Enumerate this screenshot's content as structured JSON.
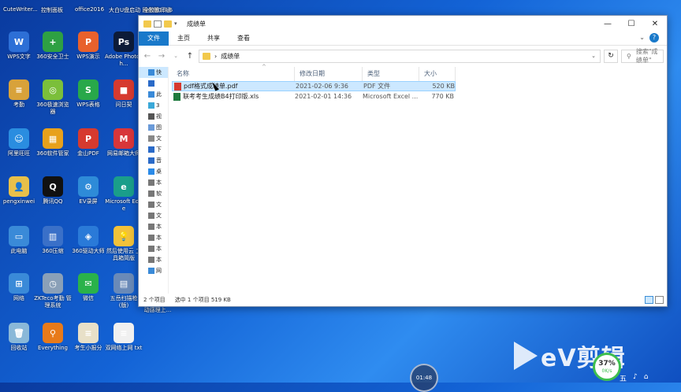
{
  "desktop": {
    "top_labels": [
      "CuteWriter...",
      "控制面板",
      "office2016",
      "大白U盘启动 网盘版1.7.5",
      "全校教师通"
    ],
    "icons": [
      {
        "label": "WPS文字",
        "icon": "wps-writer-icon",
        "color": "#2d6fd6",
        "glyph": "W"
      },
      {
        "label": "360安全卫士",
        "icon": "shield-icon",
        "color": "#2ea043",
        "glyph": "+"
      },
      {
        "label": "WPS演示",
        "icon": "wps-presentation-icon",
        "color": "#e8612c",
        "glyph": "P"
      },
      {
        "label": "Adobe Photosh...",
        "icon": "photoshop-icon",
        "color": "#0d1b38",
        "glyph": "Ps"
      },
      {
        "label": "考勤",
        "icon": "document-icon",
        "color": "#d8a23a",
        "glyph": "≡"
      },
      {
        "label": "360极速浏览器",
        "icon": "browser-icon",
        "color": "#7bbf3a",
        "glyph": "◎"
      },
      {
        "label": "WPS表格",
        "icon": "wps-spreadsheet-icon",
        "color": "#28a84a",
        "glyph": "S"
      },
      {
        "label": "问日契",
        "icon": "app-icon",
        "color": "#d63a2f",
        "glyph": "■"
      },
      {
        "label": "阿里旺旺",
        "icon": "chat-icon",
        "color": "#2a8de0",
        "glyph": "☺"
      },
      {
        "label": "360软件管家",
        "icon": "apps-icon",
        "color": "#e8a11c",
        "glyph": "▦"
      },
      {
        "label": "金山PDF",
        "icon": "pdf-icon",
        "color": "#d63a2f",
        "glyph": "P"
      },
      {
        "label": "网易邮箱大师",
        "icon": "mail-icon",
        "color": "#d8363a",
        "glyph": "M"
      },
      {
        "label": "pengxinwei",
        "icon": "user-folder-icon",
        "color": "#e8c04a",
        "glyph": "👤"
      },
      {
        "label": "腾讯QQ",
        "icon": "qq-penguin-icon",
        "color": "#111111",
        "glyph": "Q"
      },
      {
        "label": "EV录屏",
        "icon": "gear-icon",
        "color": "#2e8bd8",
        "glyph": "⚙"
      },
      {
        "label": "Microsoft Edge",
        "icon": "edge-icon",
        "color": "#1a9e8a",
        "glyph": "e"
      },
      {
        "label": "此电脑",
        "icon": "computer-icon",
        "color": "#3a8ad8",
        "glyph": "▭"
      },
      {
        "label": "360压缩",
        "icon": "archive-icon",
        "color": "#3a70c8",
        "glyph": "▥"
      },
      {
        "label": "360驱动大师",
        "icon": "driver-icon",
        "color": "#2a7ad8",
        "glyph": "◈"
      },
      {
        "label": "然后使用云 工具箱简版",
        "icon": "bulb-icon",
        "color": "#f2c23a",
        "glyph": "💡"
      },
      {
        "label": "网络",
        "icon": "network-icon",
        "color": "#3a8ad8",
        "glyph": "⊞"
      },
      {
        "label": "ZKTeco考勤 管理系统",
        "icon": "clock-icon",
        "color": "#8aa0b8",
        "glyph": "◷"
      },
      {
        "label": "微信",
        "icon": "wechat-icon",
        "color": "#2ab24a",
        "glyph": "✉"
      },
      {
        "label": "五岳扫描枪 (版)",
        "icon": "scanner-icon",
        "color": "#6a8ab8",
        "glyph": "▤"
      },
      {
        "label": "回收站",
        "icon": "recycle-bin-icon",
        "color": "#8ab8d8",
        "glyph": "🗑"
      },
      {
        "label": "Everything",
        "icon": "search-icon",
        "color": "#e87a1a",
        "glyph": "⚲"
      },
      {
        "label": "考生小报分",
        "icon": "document-icon",
        "color": "#e8e0c8",
        "glyph": "≡"
      },
      {
        "label": "双网络上网 txt",
        "icon": "text-file-icon",
        "color": "#f0f0f0",
        "glyph": "≡"
      }
    ],
    "partial_label": "动感理上..."
  },
  "window": {
    "title": "成绩单",
    "controls": {
      "minimize": "—",
      "maximize": "☐",
      "close": "✕"
    },
    "ribbon_tabs": [
      {
        "label": "文件",
        "active": true
      },
      {
        "label": "主页",
        "active": false
      },
      {
        "label": "共享",
        "active": false
      },
      {
        "label": "查看",
        "active": false
      }
    ],
    "help": "?",
    "address": {
      "path": "成绩单",
      "separator": "›",
      "refresh": "↻"
    },
    "search": {
      "placeholder": "搜索\"成绩单\""
    },
    "nav_pane": [
      {
        "label": "快",
        "icon": "star-icon",
        "color": "#3a8ad8",
        "sel": true
      },
      {
        "label": "",
        "icon": "cloud-icon",
        "color": "#2a6ac8",
        "sel": false
      },
      {
        "label": "此",
        "icon": "computer-icon",
        "color": "#3a8ad8",
        "sel": false
      },
      {
        "label": "3",
        "icon": "3d-objects-icon",
        "color": "#3aa8d8",
        "sel": false
      },
      {
        "label": "视",
        "icon": "video-icon",
        "color": "#555555",
        "sel": false
      },
      {
        "label": "图",
        "icon": "picture-icon",
        "color": "#6a9ad8",
        "sel": false
      },
      {
        "label": "文",
        "icon": "document-icon",
        "color": "#888888",
        "sel": false
      },
      {
        "label": "下",
        "icon": "download-icon",
        "color": "#2a6ac8",
        "sel": false
      },
      {
        "label": "音",
        "icon": "music-icon",
        "color": "#2a6ac8",
        "sel": false
      },
      {
        "label": "桌",
        "icon": "desktop-icon",
        "color": "#2a8ae8",
        "sel": false
      },
      {
        "label": "本",
        "icon": "drive-icon",
        "color": "#777777",
        "sel": false
      },
      {
        "label": "软",
        "icon": "drive-icon",
        "color": "#777777",
        "sel": false
      },
      {
        "label": "文",
        "icon": "drive-icon",
        "color": "#777777",
        "sel": false
      },
      {
        "label": "文",
        "icon": "drive-icon",
        "color": "#777777",
        "sel": false
      },
      {
        "label": "本",
        "icon": "drive-icon",
        "color": "#777777",
        "sel": false
      },
      {
        "label": "本",
        "icon": "drive-icon",
        "color": "#777777",
        "sel": false
      },
      {
        "label": "本",
        "icon": "drive-icon",
        "color": "#777777",
        "sel": false
      },
      {
        "label": "本",
        "icon": "drive-icon",
        "color": "#777777",
        "sel": false
      },
      {
        "label": "网",
        "icon": "network-icon",
        "color": "#3a8ad8",
        "sel": false
      }
    ],
    "columns": [
      "名称",
      "修改日期",
      "类型",
      "大小"
    ],
    "sort_arrow": "^",
    "files": [
      {
        "name": "pdf格式成绩单.pdf",
        "date": "2021-02-06 9:36",
        "type": "PDF 文件",
        "size": "520 KB",
        "icon": "pdf-file-icon",
        "color": "#d63a2f",
        "selected": true
      },
      {
        "name": "联考考生成绩B4打印版.xls",
        "date": "2021-02-01 14:36",
        "type": "Microsoft Excel ...",
        "size": "770 KB",
        "icon": "excel-file-icon",
        "color": "#1e7a3e",
        "selected": false
      }
    ],
    "status": {
      "count": "2 个项目",
      "selected": "选中 1 个项目  519 KB"
    }
  },
  "overlay": {
    "ev_text": "eV剪辑",
    "clock": "01:48",
    "gauge_value": "37%",
    "gauge_rate": "0K/s",
    "tray": [
      "五",
      "♪",
      "⌂"
    ]
  }
}
